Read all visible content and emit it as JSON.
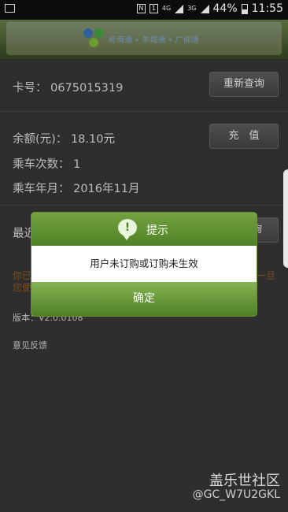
{
  "status_bar": {
    "time": "11:55",
    "battery": "44%",
    "network_4g": "4G",
    "network_3g": "3G",
    "sim": "1",
    "nfc": "N"
  },
  "header": {
    "logo_text": "岭南通 • 羊城通 • 广佛通"
  },
  "card": {
    "number_label": "卡号：",
    "number": "0675015319",
    "requery_button": "重新查询"
  },
  "balance": {
    "label": "余额(元)：",
    "value": "18.10元",
    "recharge_button": "充　值",
    "rides_label": "乘车次数：",
    "rides_value": "1",
    "month_label": "乘车年月：",
    "month_value": "2016年11月"
  },
  "background_partial": {
    "recent_label": "最近",
    "right_button_fragment": "询",
    "notice_left_1": "你已",
    "notice_left_2": "您使",
    "notice_right": "一旦",
    "version": "版本：V2.0.0108",
    "feedback": "意见反馈"
  },
  "dialog": {
    "title": "提示",
    "icon": "exclamation-bubble-icon",
    "message": "用户未订购或订购未生效",
    "ok_button": "确定"
  },
  "watermark": {
    "site": "盖乐世社区",
    "user": "@GC_W7U2GKL"
  }
}
